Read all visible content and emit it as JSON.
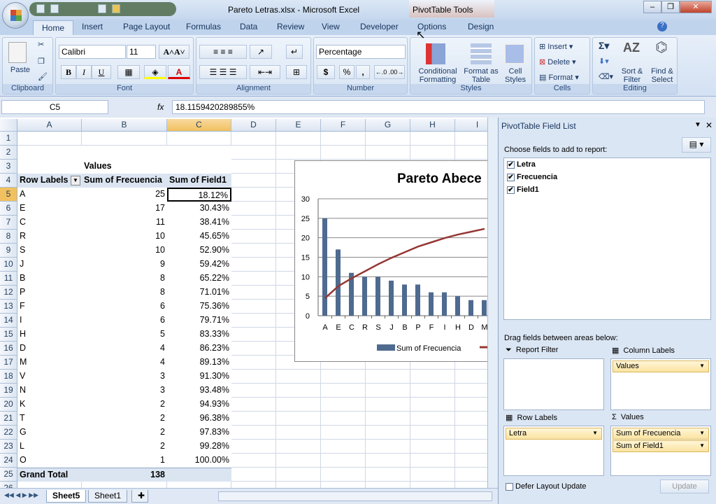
{
  "window": {
    "title": "Pareto Letras.xlsx - Microsoft Excel",
    "context_tab": "PivotTable Tools"
  },
  "tabs": [
    "Home",
    "Insert",
    "Page Layout",
    "Formulas",
    "Data",
    "Review",
    "View",
    "Developer",
    "Options",
    "Design"
  ],
  "ribbon": {
    "clipboard": {
      "label": "Clipboard",
      "paste": "Paste"
    },
    "font": {
      "label": "Font",
      "name": "Calibri",
      "size": "11",
      "bold": "B",
      "italic": "I",
      "underline": "U"
    },
    "alignment": {
      "label": "Alignment"
    },
    "number": {
      "label": "Number",
      "format": "Percentage",
      "currency": "$",
      "percent": "%",
      "comma": ","
    },
    "styles": {
      "label": "Styles",
      "conditional": "Conditional Formatting",
      "format_table": "Format as Table",
      "cell_styles": "Cell Styles"
    },
    "cells": {
      "label": "Cells",
      "insert": "Insert",
      "delete": "Delete",
      "format": "Format"
    },
    "editing": {
      "label": "Editing",
      "sort": "Sort & Filter",
      "find": "Find & Select"
    }
  },
  "formula_bar": {
    "name_box": "C5",
    "fx": "fx",
    "value": "18.1159420289855%"
  },
  "columns": [
    "A",
    "B",
    "C",
    "D",
    "E",
    "F",
    "G",
    "H",
    "I"
  ],
  "selected_cell": "C5",
  "pivot": {
    "values_header": "Values",
    "headers": [
      "Row Labels",
      "Sum of Frecuencia",
      "Sum of Field1"
    ],
    "rows": [
      [
        "A",
        "25",
        "18.12%"
      ],
      [
        "E",
        "17",
        "30.43%"
      ],
      [
        "C",
        "11",
        "38.41%"
      ],
      [
        "R",
        "10",
        "45.65%"
      ],
      [
        "S",
        "10",
        "52.90%"
      ],
      [
        "J",
        "9",
        "59.42%"
      ],
      [
        "B",
        "8",
        "65.22%"
      ],
      [
        "P",
        "8",
        "71.01%"
      ],
      [
        "F",
        "6",
        "75.36%"
      ],
      [
        "I",
        "6",
        "79.71%"
      ],
      [
        "H",
        "5",
        "83.33%"
      ],
      [
        "D",
        "4",
        "86.23%"
      ],
      [
        "M",
        "4",
        "89.13%"
      ],
      [
        "V",
        "3",
        "91.30%"
      ],
      [
        "N",
        "3",
        "93.48%"
      ],
      [
        "K",
        "2",
        "94.93%"
      ],
      [
        "T",
        "2",
        "96.38%"
      ],
      [
        "G",
        "2",
        "97.83%"
      ],
      [
        "L",
        "2",
        "99.28%"
      ],
      [
        "O",
        "1",
        "100.00%"
      ]
    ],
    "grand_total": [
      "Grand Total",
      "138"
    ]
  },
  "chart_data": {
    "type": "bar",
    "title": "Pareto Abece",
    "categories": [
      "A",
      "E",
      "C",
      "R",
      "S",
      "J",
      "B",
      "P",
      "F",
      "I",
      "H",
      "D",
      "M"
    ],
    "series": [
      {
        "name": "Sum of Frecuencia",
        "type": "bar",
        "values": [
          25,
          17,
          11,
          10,
          10,
          9,
          8,
          8,
          6,
          6,
          5,
          4,
          4
        ],
        "color": "#4f6a8f"
      },
      {
        "type": "line",
        "values": [
          18.12,
          30.43,
          38.41,
          45.65,
          52.9,
          59.42,
          65.22,
          71.01,
          75.36,
          79.71,
          83.33,
          86.23,
          89.13
        ],
        "color": "#953735"
      }
    ],
    "yticks": [
      "0",
      "5",
      "10",
      "15",
      "20",
      "25",
      "30"
    ],
    "ylim": [
      0,
      30
    ],
    "grid": true,
    "legend": "bottom"
  },
  "sheets": [
    "Sheet5",
    "Sheet1"
  ],
  "field_list": {
    "title": "PivotTable Field List",
    "choose": "Choose fields to add to report:",
    "fields": [
      {
        "name": "Letra",
        "checked": true
      },
      {
        "name": "Frecuencia",
        "checked": true
      },
      {
        "name": "Field1",
        "checked": true
      }
    ],
    "drag": "Drag fields between areas below:",
    "report_filter": "Report Filter",
    "column_labels": "Column Labels",
    "row_labels": "Row Labels",
    "values": "Values",
    "column_items": [
      "Values"
    ],
    "row_items": [
      "Letra"
    ],
    "value_items": [
      "Sum of Frecuencia",
      "Sum of Field1"
    ],
    "defer": "Defer Layout Update",
    "update": "Update"
  }
}
